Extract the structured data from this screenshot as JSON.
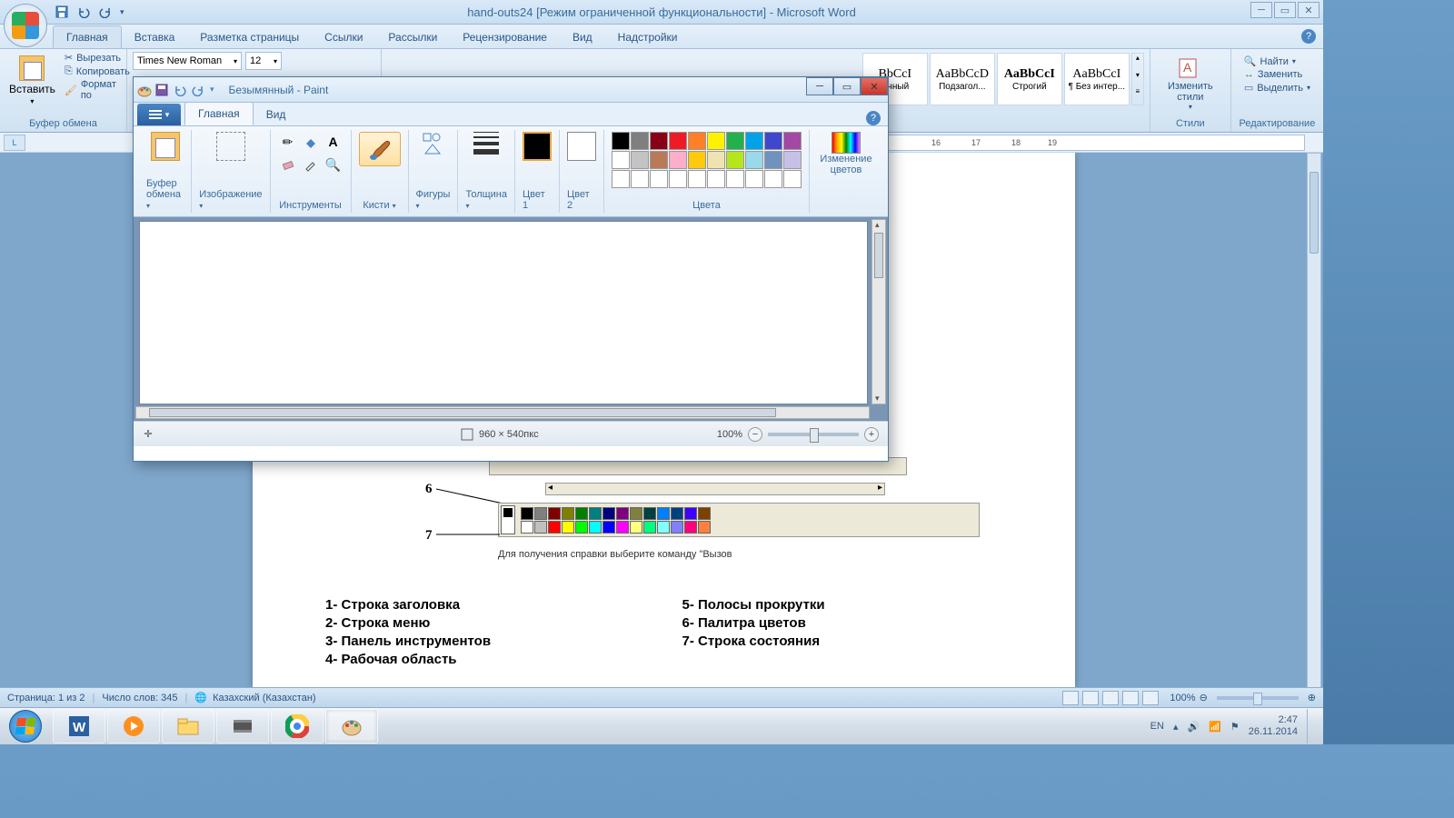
{
  "word": {
    "title": "hand-outs24 [Режим ограниченной функциональности] - Microsoft Word",
    "tabs": [
      "Главная",
      "Вставка",
      "Разметка страницы",
      "Ссылки",
      "Рассылки",
      "Рецензирование",
      "Вид",
      "Надстройки"
    ],
    "active_tab": 0,
    "clipboard": {
      "paste": "Вставить",
      "cut": "Вырезать",
      "copy": "Копировать",
      "format_painter": "Формат по",
      "group_label": "Буфер обмена"
    },
    "font": {
      "name": "Times New Roman",
      "size": "12"
    },
    "styles": {
      "items": [
        {
          "preview": "BbCcI",
          "label": "ычный"
        },
        {
          "preview": "AaBbCcD",
          "label": "Подзагол..."
        },
        {
          "preview": "AaBbCcI",
          "label": "Строгий"
        },
        {
          "preview": "AaBbCcI",
          "label": "¶ Без интер..."
        }
      ],
      "change": "Изменить стили",
      "group_label": "Стили"
    },
    "editing": {
      "find": "Найти",
      "replace": "Заменить",
      "select": "Выделить",
      "group_label": "Редактирование"
    },
    "ruler_marks": [
      "16",
      "17",
      "18",
      "19"
    ],
    "doc_content": {
      "callout_6": "6",
      "callout_7": "7",
      "status_old": "Для получения справки выберите команду \"Вызов",
      "legend_left": [
        "1-   Строка заголовка",
        "2-   Строка меню",
        "3-   Панель инструментов",
        "4-   Рабочая область"
      ],
      "legend_right": [
        "5-   Полосы прокрутки",
        "6-   Палитра цветов",
        "7-   Строка состояния"
      ]
    },
    "status": {
      "page": "Страница: 1 из 2",
      "words": "Число слов: 345",
      "lang": "Казахский (Казахстан)",
      "zoom": "100%"
    }
  },
  "paint": {
    "title": "Безымянный - Paint",
    "tabs": [
      "Главная",
      "Вид"
    ],
    "active_tab": 0,
    "ribbon": {
      "clipboard": "Буфер обмена",
      "image": "Изображение",
      "tools": "Инструменты",
      "brushes": "Кисти",
      "shapes": "Фигуры",
      "thickness": "Толщина",
      "color1": "Цвет 1",
      "color2": "Цвет 2",
      "colors_group": "Цвета",
      "edit_colors": "Изменение цветов"
    },
    "palette_row1": [
      "#000000",
      "#7f7f7f",
      "#880015",
      "#ed1c24",
      "#ff7f27",
      "#fff200",
      "#22b14c",
      "#00a2e8",
      "#3f48cc",
      "#a349a4"
    ],
    "palette_row2": [
      "#ffffff",
      "#c3c3c3",
      "#b97a57",
      "#ffaec9",
      "#ffc90e",
      "#efe4b0",
      "#b5e61d",
      "#99d9ea",
      "#7092be",
      "#c8bfe7"
    ],
    "status": {
      "dims": "960 × 540пкс",
      "zoom": "100%"
    }
  },
  "taskbar": {
    "lang": "EN",
    "time": "2:47",
    "date": "26.11.2014"
  },
  "old_palette": [
    "#000",
    "#808080",
    "#800000",
    "#808000",
    "#008000",
    "#008080",
    "#000080",
    "#800080",
    "#808040",
    "#004040",
    "#0080ff",
    "#004080",
    "#4000ff",
    "#804000",
    "#fff",
    "#c0c0c0",
    "#f00",
    "#ff0",
    "#0f0",
    "#0ff",
    "#00f",
    "#f0f",
    "#ffff80",
    "#00ff80",
    "#80ffff",
    "#8080ff",
    "#ff0080",
    "#ff8040"
  ]
}
